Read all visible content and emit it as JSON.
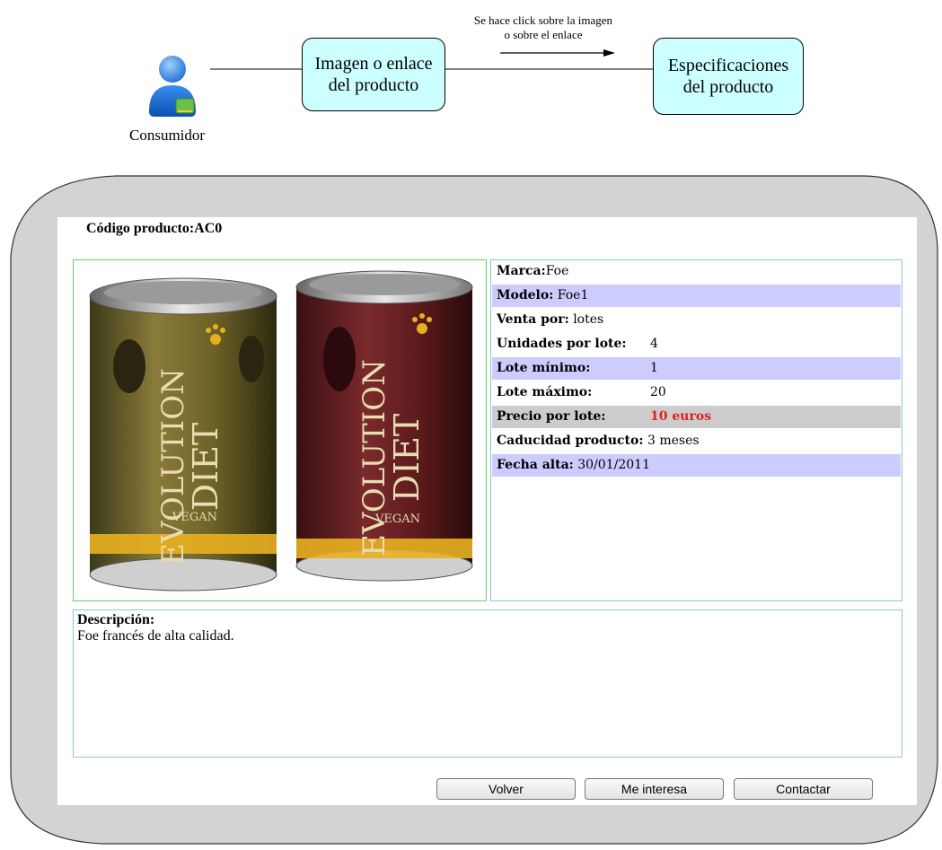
{
  "diagram": {
    "actor_label": "Consumidor",
    "box_product": [
      "Imagen o enlace",
      "del producto"
    ],
    "box_specs": [
      "Especificaciones",
      "del producto"
    ],
    "arrow_note": [
      "Se hace click sobre la imagen",
      "o sobre el enlace"
    ]
  },
  "product": {
    "code_title": "Código producto:AC0",
    "specs": [
      {
        "label": "Marca:",
        "value": "Foe"
      },
      {
        "label": "Modelo:",
        "value": " Foe1"
      },
      {
        "label": "Venta por:",
        "value": " lotes"
      },
      {
        "label": "Unidades por lote:",
        "value": "4"
      },
      {
        "label": "Lote mínimo:",
        "value": "1"
      },
      {
        "label": "Lote máximo:",
        "value": "20"
      },
      {
        "label": "Precio por lote:",
        "value": "10 euros"
      },
      {
        "label": "Caducidad producto:",
        "value": " 3 meses"
      },
      {
        "label": "Fecha alta:",
        "value": " 30/01/2011"
      }
    ],
    "can_brand": [
      "EVOLUTION",
      "DIET"
    ],
    "can_vegan": "VEGAN",
    "description_title": "Descripción:",
    "description_text": "Foe francés de alta calidad."
  },
  "buttons": {
    "back": "Volver",
    "interested": "Me interesa",
    "contact": "Contactar"
  },
  "colors": {
    "box_fill": "#ccffff",
    "row_band": "#ccccff",
    "price_band": "#cccccc",
    "price_text": "#e02020",
    "frame_gray": "#d3d3d3"
  }
}
